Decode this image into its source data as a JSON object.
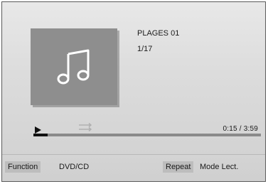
{
  "now_playing": {
    "title": "PLAGES 01",
    "track_index": "1/17",
    "elapsed": "0:15",
    "separator": "/",
    "total": "3:59",
    "progress_fraction": 0.063
  },
  "icons": {
    "album_art": "music-note-icon",
    "play": "play-icon",
    "shuffle": "shuffle-icon"
  },
  "bottom_bar": {
    "function_key": "Function",
    "function_value": "DVD/CD",
    "repeat_key": "Repeat",
    "repeat_value": "Mode Lect."
  },
  "colors": {
    "album_bg": "#8e8e8e",
    "highlight_tag": "#bdbdbd"
  }
}
